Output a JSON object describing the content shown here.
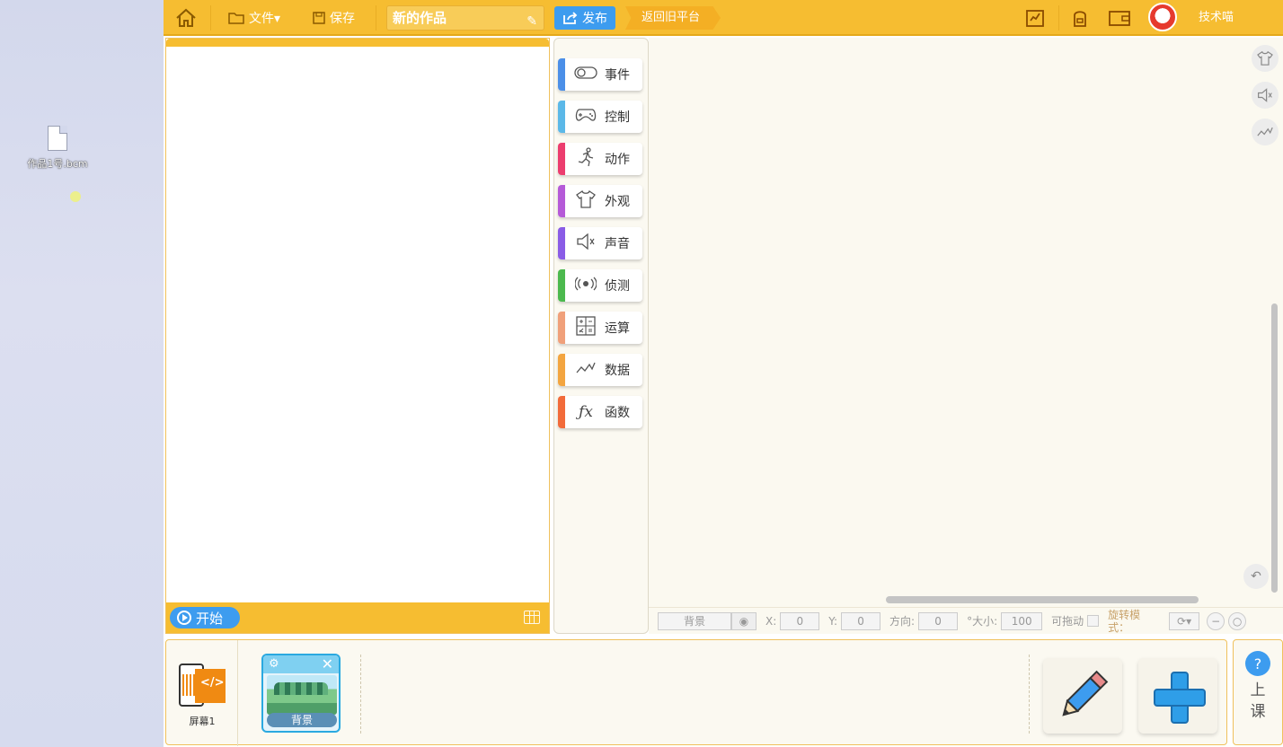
{
  "desktop": {
    "file_name": "作品1号.bcm"
  },
  "topbar": {
    "home_icon": "home-icon",
    "file_menu": "文件▾",
    "save": "保存",
    "project_title": "新的作品",
    "publish": "发布",
    "back_old": "返回旧平台",
    "username": "技术喵"
  },
  "stage": {
    "start": "开始"
  },
  "categories": [
    {
      "label": "事件",
      "icon": "toggle-icon",
      "color": "#4b8fe8"
    },
    {
      "label": "控制",
      "icon": "gamepad-icon",
      "color": "#5bb8e8"
    },
    {
      "label": "动作",
      "icon": "running-icon",
      "color": "#ec3d6e"
    },
    {
      "label": "外观",
      "icon": "shirt-icon",
      "color": "#b55ad8"
    },
    {
      "label": "声音",
      "icon": "speaker-icon",
      "color": "#8a5ce6"
    },
    {
      "label": "侦测",
      "icon": "radar-icon",
      "color": "#4cb94e"
    },
    {
      "label": "运算",
      "icon": "calculator-icon",
      "color": "#f0a07a"
    },
    {
      "label": "数据",
      "icon": "chart-icon",
      "color": "#f3a540"
    },
    {
      "label": "函数",
      "icon": "function-icon",
      "color": "#f26b3a"
    }
  ],
  "props": {
    "sprite_name": "背景",
    "x_label": "X:",
    "x_value": "0",
    "y_label": "Y:",
    "y_value": "0",
    "direction_label": "方向:",
    "direction_value": "0",
    "size_label": "°大小:",
    "size_value": "100",
    "draggable_label": "可拖动",
    "rotation_label": "旋转模式："
  },
  "bottom": {
    "screen_label": "屏幕1",
    "sprite_label": "背景"
  },
  "class_button": {
    "line1": "上",
    "line2": "课"
  }
}
